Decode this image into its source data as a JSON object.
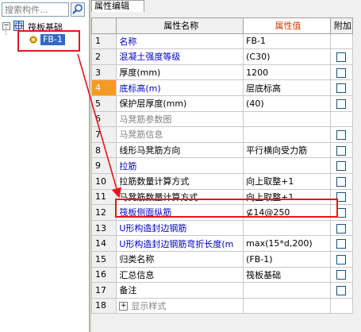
{
  "left_panel": {
    "search_placeholder": "搜索构件...",
    "tree": {
      "root_label": "筏板基础",
      "child_label": "FB-1"
    }
  },
  "right_panel": {
    "tab_label": "属性编辑",
    "headers": {
      "name": "属性名称",
      "value": "属性值",
      "extra": "附加"
    },
    "rows": [
      {
        "num": "1",
        "name": "名称",
        "value": "FB-1",
        "check": false,
        "color": "blue"
      },
      {
        "num": "2",
        "name": "混凝土强度等级",
        "value": "(C30)",
        "check": true,
        "color": "blue"
      },
      {
        "num": "3",
        "name": "厚度(mm)",
        "value": "1200",
        "check": true,
        "color": "black"
      },
      {
        "num": "4",
        "name": "底标高(m)",
        "value": "层底标高",
        "check": true,
        "color": "blue"
      },
      {
        "num": "5",
        "name": "保护层厚度(mm)",
        "value": "(40)",
        "check": true,
        "color": "black"
      },
      {
        "num": "6",
        "name": "马凳筋参数图",
        "value": "",
        "check": false,
        "color": "gray"
      },
      {
        "num": "7",
        "name": "马凳筋信息",
        "value": "",
        "check": true,
        "color": "gray"
      },
      {
        "num": "8",
        "name": "线形马凳筋方向",
        "value": "平行横向受力筋",
        "check": true,
        "color": "black"
      },
      {
        "num": "9",
        "name": "拉筋",
        "value": "",
        "check": true,
        "color": "blue"
      },
      {
        "num": "10",
        "name": "拉筋数量计算方式",
        "value": "向上取整+1",
        "check": true,
        "color": "black"
      },
      {
        "num": "11",
        "name": "马凳筋数量计算方式",
        "value": "向上取整+1",
        "check": true,
        "color": "black"
      },
      {
        "num": "12",
        "name": "筏板侧面纵筋",
        "value": "⊈14@250",
        "check": true,
        "color": "blue"
      },
      {
        "num": "13",
        "name": "U形构造封边钢筋",
        "value": "",
        "check": true,
        "color": "blue"
      },
      {
        "num": "14",
        "name": "U形构造封边钢筋弯折长度(m",
        "value": "max(15*d,200)",
        "check": true,
        "color": "blue"
      },
      {
        "num": "15",
        "name": "归类名称",
        "value": "(FB-1)",
        "check": true,
        "color": "black"
      },
      {
        "num": "16",
        "name": "汇总信息",
        "value": "筏板基础",
        "check": true,
        "color": "black"
      },
      {
        "num": "17",
        "name": "备注",
        "value": "",
        "check": true,
        "color": "black"
      },
      {
        "num": "18",
        "name": "显示样式",
        "value": "",
        "check": false,
        "color": "gray",
        "expander": "+"
      }
    ],
    "selected_row": "4"
  },
  "colors": {
    "highlight_red": "#e8141c",
    "selection_blue": "#316ac5",
    "selected_row_orange": "#f59a23",
    "value_header_red": "#d23c00"
  }
}
